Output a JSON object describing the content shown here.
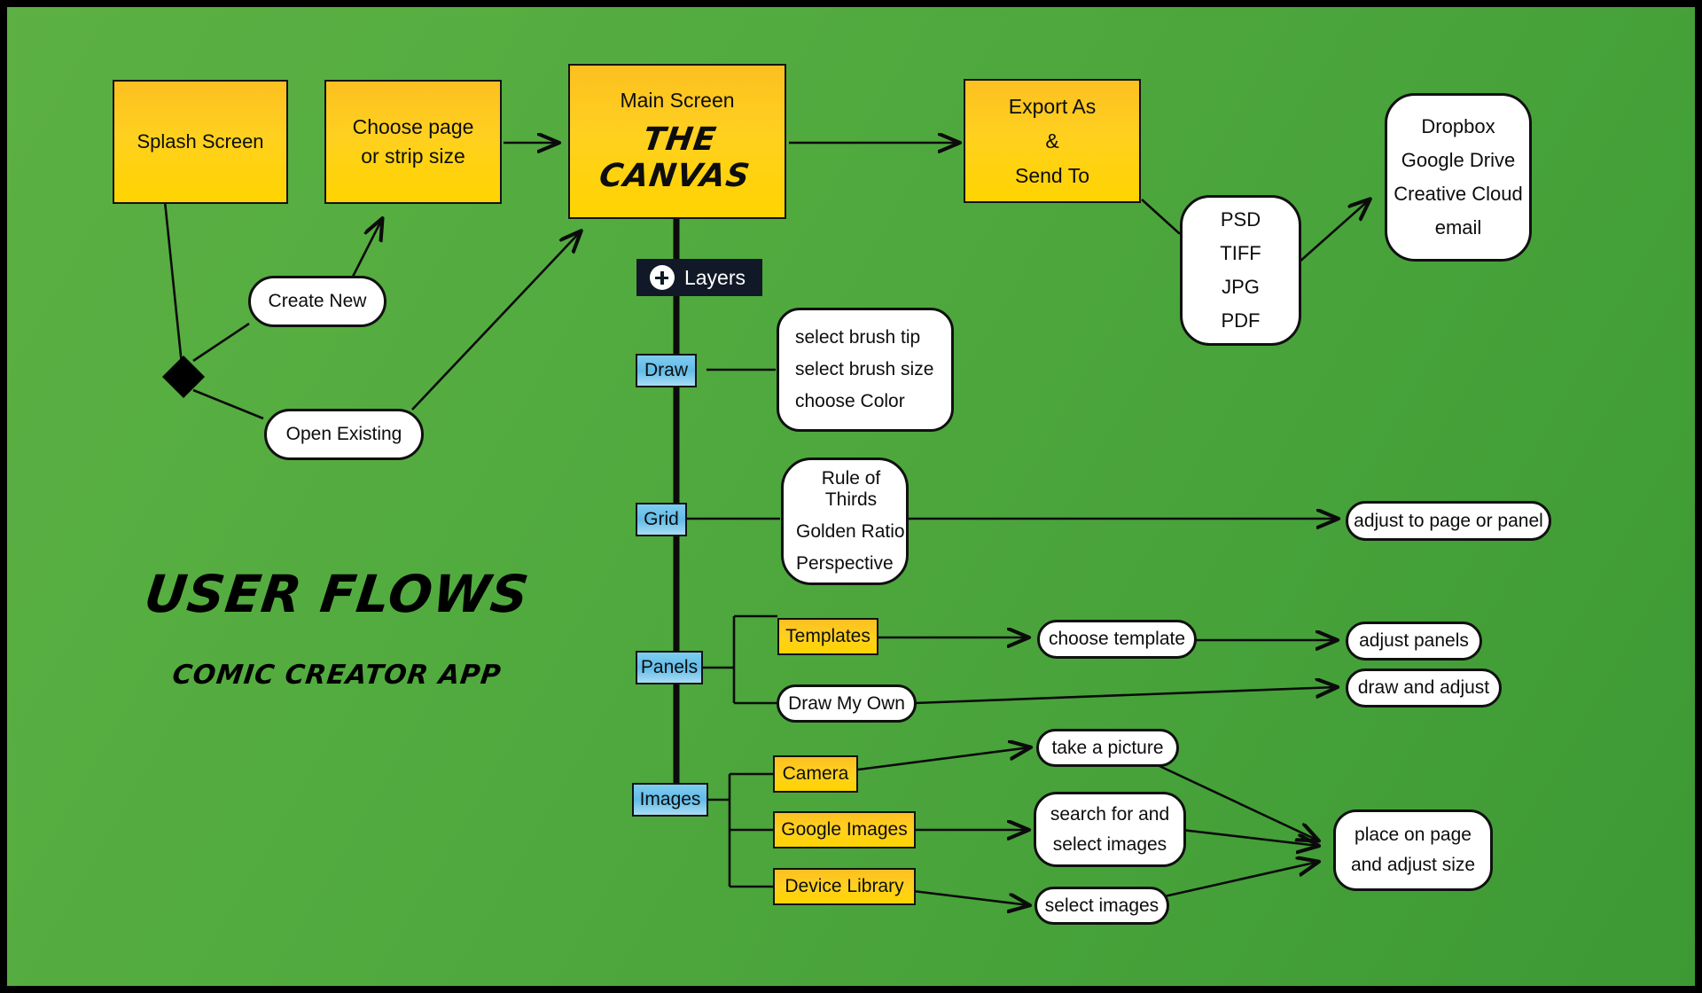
{
  "diagram": {
    "title": "USER FLOWS",
    "subtitle": "COMIC CREATOR APP",
    "background_color": "#4fa93c",
    "accent_yellow": "#ffd01f",
    "accent_blue": "#62bce8",
    "dark_color": "#111827"
  },
  "nodes": {
    "splash_screen": "Splash Screen",
    "choose_size_line1": "Choose page",
    "choose_size_line2": "or strip size",
    "main_screen_label": "Main Screen",
    "main_screen_title": "THE CANVAS",
    "export_line1": "Export As",
    "export_line2": "&",
    "export_line3": "Send To",
    "create_new": "Create New",
    "open_existing": "Open Existing",
    "layers": "Layers",
    "layers_icon": "plus-icon",
    "draw": "Draw",
    "grid": "Grid",
    "panels": "Panels",
    "images": "Images",
    "templates": "Templates",
    "draw_my_own": "Draw My Own",
    "camera": "Camera",
    "google_images": "Google Images",
    "device_library": "Device Library"
  },
  "lists": {
    "file_formats": [
      "PSD",
      "TIFF",
      "JPG",
      "PDF"
    ],
    "destinations": [
      "Dropbox",
      "Google Drive",
      "Creative Cloud",
      "email"
    ],
    "draw_options": [
      "select brush tip",
      "select brush size",
      "choose Color"
    ],
    "grid_options": [
      "Rule of Thirds",
      "Golden Ratio",
      "Perspective"
    ]
  },
  "outcomes": {
    "adjust_to_page_or_panel": "adjust to page or panel",
    "choose_template": "choose template",
    "adjust_panels": "adjust panels",
    "draw_and_adjust": "draw and adjust",
    "take_a_picture": "take a picture",
    "search_select_line1": "search for and",
    "search_select_line2": "select images",
    "select_images": "select images",
    "place_line1": "place on page",
    "place_line2": "and adjust size"
  }
}
